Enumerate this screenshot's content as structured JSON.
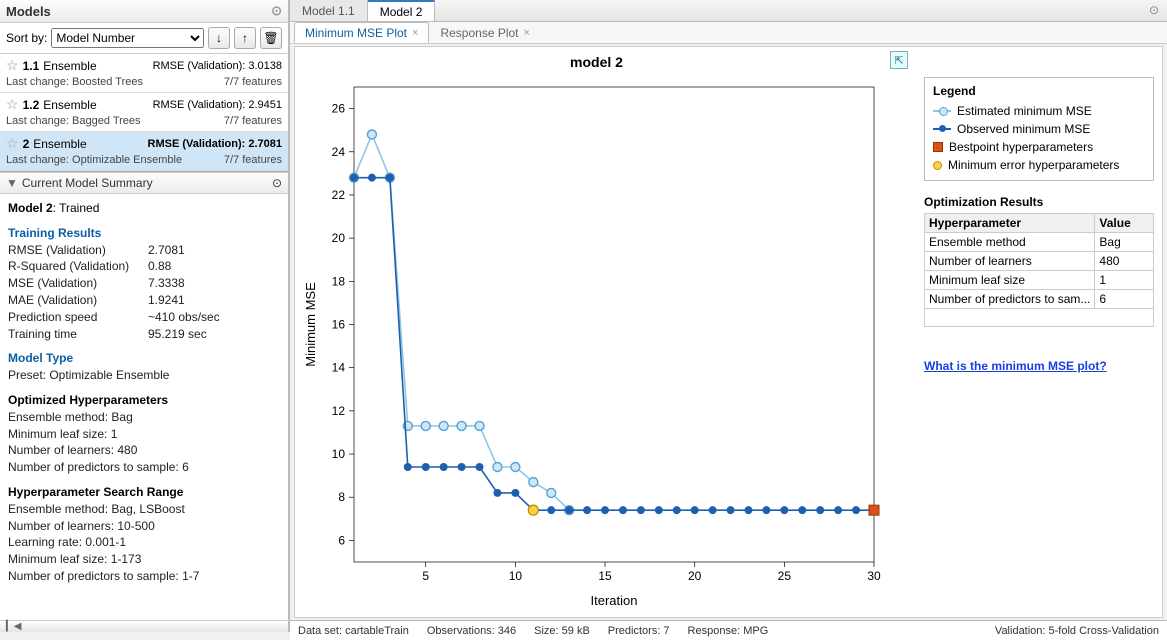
{
  "panels": {
    "models_title": "Models",
    "sort_label": "Sort by:",
    "sort_value": "Model Number",
    "summary_title": "Current Model Summary"
  },
  "models": [
    {
      "num": "1.1",
      "type": "Ensemble",
      "rmse_label": "RMSE (Validation):",
      "rmse": "3.0138",
      "last_change_label": "Last change:",
      "last_change": "Boosted Trees",
      "features": "7/7 features",
      "selected": false
    },
    {
      "num": "1.2",
      "type": "Ensemble",
      "rmse_label": "RMSE (Validation):",
      "rmse": "2.9451",
      "last_change_label": "Last change:",
      "last_change": "Bagged Trees",
      "features": "7/7 features",
      "selected": false
    },
    {
      "num": "2",
      "type": "Ensemble",
      "rmse_label": "RMSE (Validation):",
      "rmse": "2.7081",
      "last_change_label": "Last change:",
      "last_change": "Optimizable Ensemble",
      "features": "7/7 features",
      "selected": true
    }
  ],
  "summary": {
    "model_label": "Model 2",
    "model_status": ": Trained",
    "training_results_title": "Training Results",
    "metrics": [
      {
        "k": "RMSE (Validation)",
        "v": "2.7081"
      },
      {
        "k": "R-Squared (Validation)",
        "v": "0.88"
      },
      {
        "k": "MSE (Validation)",
        "v": "7.3338"
      },
      {
        "k": "MAE (Validation)",
        "v": "1.9241"
      },
      {
        "k": "Prediction speed",
        "v": "~410 obs/sec"
      },
      {
        "k": "Training time",
        "v": "95.219 sec"
      }
    ],
    "model_type_title": "Model Type",
    "preset": "Preset: Optimizable Ensemble",
    "opt_hp_title": "Optimized Hyperparameters",
    "opt_hp_lines": [
      "Ensemble method: Bag",
      "Minimum leaf size: 1",
      "Number of learners: 480",
      "Number of predictors to sample: 6"
    ],
    "hp_search_title": "Hyperparameter Search Range",
    "hp_search_lines": [
      "Ensemble method: Bag, LSBoost",
      "Number of learners: 10-500",
      "Learning rate: 0.001-1",
      "Minimum leaf size: 1-173",
      "Number of predictors to sample: 1-7"
    ]
  },
  "tabs": {
    "top": [
      {
        "label": "Model 1.1",
        "active": false
      },
      {
        "label": "Model 2",
        "active": true
      }
    ],
    "sub": [
      {
        "label": "Minimum MSE Plot",
        "active": true
      },
      {
        "label": "Response Plot",
        "active": false
      }
    ]
  },
  "legend": {
    "title": "Legend",
    "items": [
      "Estimated minimum MSE",
      "Observed minimum MSE",
      "Bestpoint hyperparameters",
      "Minimum error hyperparameters"
    ]
  },
  "opt_results": {
    "title": "Optimization Results",
    "headers": [
      "Hyperparameter",
      "Value"
    ],
    "rows": [
      [
        "Ensemble method",
        "Bag"
      ],
      [
        "Number of learners",
        "480"
      ],
      [
        "Minimum leaf size",
        "1"
      ],
      [
        "Number of predictors to sam...",
        "6"
      ]
    ],
    "link": "What is the minimum MSE plot?"
  },
  "status": {
    "dataset": "Data set: cartableTrain",
    "observations": "Observations: 346",
    "size": "Size: 59 kB",
    "predictors": "Predictors: 7",
    "response": "Response: MPG",
    "validation": "Validation: 5-fold Cross-Validation"
  },
  "chart_data": {
    "type": "line",
    "title": "model 2",
    "xlabel": "Iteration",
    "ylabel": "Minimum MSE",
    "xlim": [
      1,
      30
    ],
    "ylim": [
      5,
      27
    ],
    "xticks": [
      5,
      10,
      15,
      20,
      25,
      30
    ],
    "yticks": [
      6,
      8,
      10,
      12,
      14,
      16,
      18,
      20,
      22,
      24,
      26
    ],
    "series": [
      {
        "name": "Estimated minimum MSE",
        "color": "#8fc6e8",
        "values": [
          22.8,
          24.8,
          22.8,
          11.3,
          11.3,
          11.3,
          11.3,
          11.3,
          9.4,
          9.4,
          8.7,
          8.2,
          7.4
        ]
      },
      {
        "name": "Observed minimum MSE",
        "color": "#1f5fb0",
        "values": [
          22.8,
          22.8,
          22.8,
          9.4,
          9.4,
          9.4,
          9.4,
          9.4,
          8.2,
          8.2,
          7.4,
          7.4,
          7.4,
          7.4,
          7.4,
          7.4,
          7.4,
          7.4,
          7.4,
          7.4,
          7.4,
          7.4,
          7.4,
          7.4,
          7.4,
          7.4,
          7.4,
          7.4,
          7.4,
          7.4
        ]
      }
    ],
    "bestpoint_x": 30,
    "bestpoint_y": 7.4,
    "minerror_x": 11,
    "minerror_y": 7.4
  }
}
